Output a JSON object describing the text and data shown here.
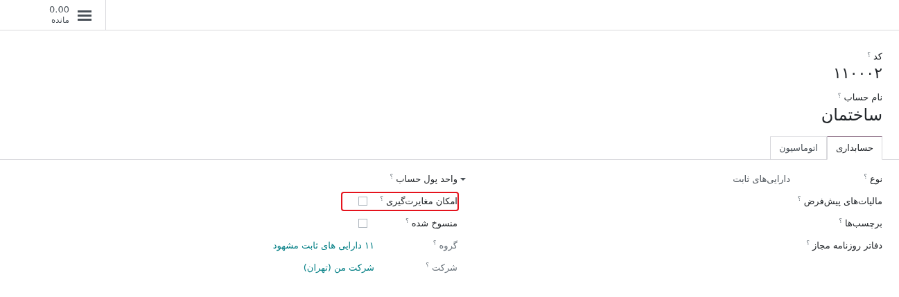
{
  "header": {
    "balance": "0.00",
    "balance_label": "مانده"
  },
  "title_fields": [
    {
      "label": "کد",
      "help": "؟",
      "value": "۱۱۰۰۰۲"
    },
    {
      "label": "نام حساب",
      "help": "؟",
      "value": "ساختمان"
    }
  ],
  "tabs": [
    {
      "label": "حسابداری",
      "selected": true
    },
    {
      "label": "اتوماسیون",
      "selected": false
    }
  ],
  "groups": [
    {
      "fields": [
        {
          "kind": "select",
          "label": "نوع",
          "help": "؟",
          "value": "دارایی‌های ثابت"
        },
        {
          "kind": "empty",
          "label": "مالیات‌های پیش‌فرض",
          "help": "؟"
        },
        {
          "kind": "empty",
          "label": "برچسب‌ها",
          "help": "؟"
        },
        {
          "kind": "empty",
          "label": "دفاتر روزنامه مجاز",
          "help": "؟"
        }
      ]
    },
    {
      "fields": [
        {
          "kind": "empty",
          "label": "واحد پول حساب",
          "help": "؟"
        },
        {
          "kind": "checkbox",
          "label": "امکان مغایرت‌گیری",
          "help": "؟",
          "checked": false,
          "highlighted": true
        },
        {
          "kind": "checkbox",
          "label": "منسوخ شده",
          "help": "؟",
          "checked": false,
          "highlighted": false
        },
        {
          "kind": "link",
          "label": "گروه",
          "help": "؟",
          "value": "۱۱ دارایی های ثابت مشهود",
          "readonly": true
        },
        {
          "kind": "link",
          "label": "شرکت",
          "help": "؟",
          "value": "شرکت من (تهران)",
          "readonly": true
        }
      ]
    }
  ]
}
